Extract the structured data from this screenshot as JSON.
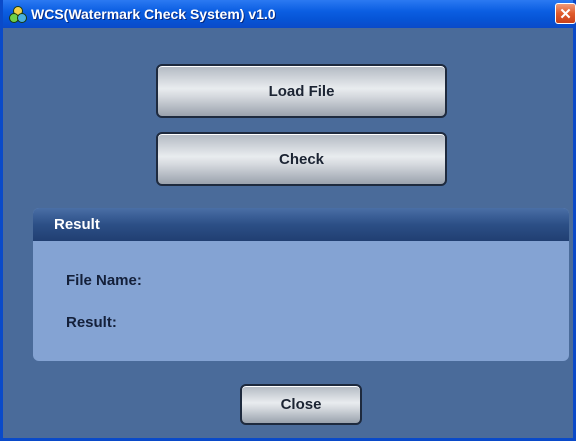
{
  "window": {
    "title": "WCS(Watermark Check System) v1.0",
    "close_glyph": "✕",
    "app_icon": "app-logo-icon"
  },
  "buttons": {
    "load_file": "Load File",
    "check": "Check",
    "close": "Close"
  },
  "result_panel": {
    "header": "Result",
    "file_name_label": "File Name:",
    "result_label": "Result:"
  },
  "colors": {
    "window_bg": "#4a6b9a",
    "panel_bg": "#84a3d3",
    "title_bar": "#0654d6",
    "close_button": "#e05a2a"
  }
}
